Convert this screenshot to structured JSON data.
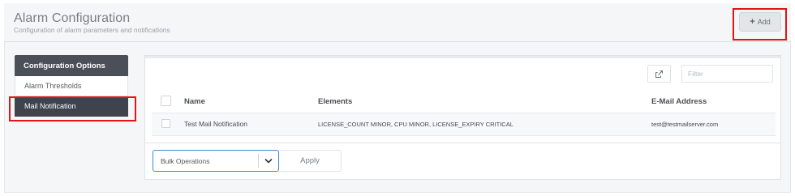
{
  "header": {
    "title": "Alarm Configuration",
    "subtitle": "Configuration of alarm parameters and notifications",
    "add_icon": "plus-icon",
    "add_label": "Add"
  },
  "sidebar": {
    "title": "Configuration Options",
    "items": [
      {
        "label": "Alarm Thresholds",
        "active": false
      },
      {
        "label": "Mail Notification",
        "active": true
      }
    ]
  },
  "toolbar": {
    "export_icon": "export-icon",
    "filter_placeholder": "Filter"
  },
  "table": {
    "columns": [
      "Name",
      "Elements",
      "E-Mail Address"
    ],
    "rows": [
      {
        "name": "Test Mail Notification",
        "elements": "LICENSE_COUNT MINOR, CPU MINOR, LICENSE_EXPIRY CRITICAL",
        "email": "test@testmailserver.com"
      }
    ]
  },
  "footer": {
    "bulk_selected": "Bulk Operations",
    "apply_label": "Apply"
  },
  "colors": {
    "highlight": "#e01515",
    "sidebar_header": "#4a4f58",
    "sidebar_active": "#3f434b",
    "select_focus": "#3a8bd8"
  }
}
